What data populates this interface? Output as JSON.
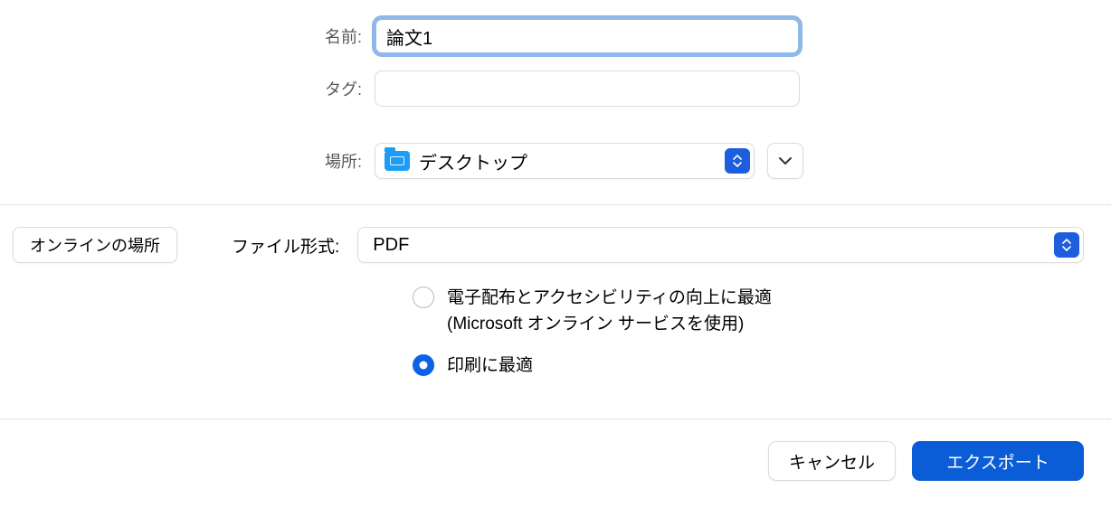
{
  "labels": {
    "name": "名前:",
    "tags": "タグ:",
    "location": "場所:",
    "fileFormat": "ファイル形式:",
    "onlineLocations": "オンラインの場所"
  },
  "values": {
    "name": "論文1",
    "tags": "",
    "location": "デスクトップ",
    "format": "PDF"
  },
  "radios": {
    "optDigital": "電子配布とアクセシビリティの向上に最適",
    "optDigitalSub": "(Microsoft オンライン サービスを使用)",
    "optPrint": "印刷に最適",
    "selected": "print"
  },
  "buttons": {
    "cancel": "キャンセル",
    "export": "エクスポート"
  }
}
